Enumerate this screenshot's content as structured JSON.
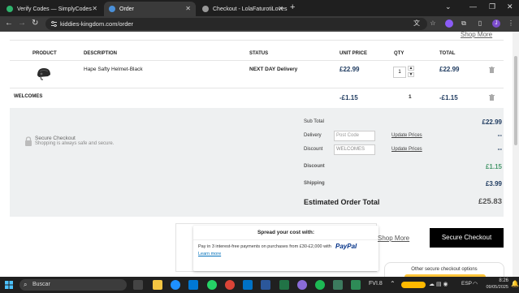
{
  "browser": {
    "tabs": [
      {
        "title": "Verify Codes — SimplyCodes",
        "active": false,
        "favicon_color": "#2fb36d"
      },
      {
        "title": "Order",
        "active": true,
        "favicon_color": "#4a90d9"
      },
      {
        "title": "Checkout - LolaFaturotiLoves",
        "active": false,
        "favicon_color": "#999999"
      }
    ],
    "new_tab_glyph": "+",
    "url": "kiddies-kingdom.com/order",
    "profile_initial": "J"
  },
  "page": {
    "shop_more_top": "Shop More",
    "table": {
      "headers": {
        "product": "PRODUCT",
        "description": "DESCRIPTION",
        "status": "STATUS",
        "unit_price": "UNIT PRICE",
        "qty": "QTY",
        "total": "TOTAL"
      },
      "row": {
        "description": "Hape Safty Helmet-Black",
        "status": "NEXT DAY Delivery",
        "unit_price": "£22.99",
        "qty": "1",
        "total": "£22.99"
      },
      "discount_row": {
        "label": "WELCOMES",
        "unit_price": "-£1.15",
        "qty": "1",
        "total": "-£1.15"
      }
    },
    "secure": {
      "title": "Secure Checkout",
      "subtitle": "Shopping is always safe and secure."
    },
    "summary": {
      "sub_total_label": "Sub Total",
      "sub_total_value": "£22.99",
      "delivery_label": "Delivery",
      "delivery_placeholder": "Post Code",
      "delivery_link": "Update Prices",
      "delivery_value": "--",
      "discount_label": "Discount",
      "discount_input_value": "WELCOMES",
      "discount_link": "Update Prices",
      "discount_value": "--",
      "discount2_label": "Discount",
      "discount2_value": "£1.15",
      "shipping_label": "Shipping",
      "shipping_value": "£3.99",
      "estimated_label": "Estimated Order Total",
      "estimated_value": "£25.83"
    },
    "spread": {
      "title": "Spread your cost with:",
      "text": "Pay in 3 interest-free payments on purchases from £30-£2,000 with",
      "brand": "PayPal",
      "learn_more": "Learn more"
    },
    "shop_more_bottom": "Shop More",
    "secure_checkout_button": "Secure Checkout",
    "other_options": "Other secure checkout options"
  },
  "taskbar": {
    "search_placeholder": "Buscar",
    "stock_label": "FVI.8",
    "language": "ESP",
    "time": "8:26",
    "date": "09/05/2025"
  },
  "colors": {
    "navy": "#1e3a5f",
    "green": "#4a9a6e",
    "paypal_blue": "#003087",
    "paypal_light": "#009cde"
  }
}
